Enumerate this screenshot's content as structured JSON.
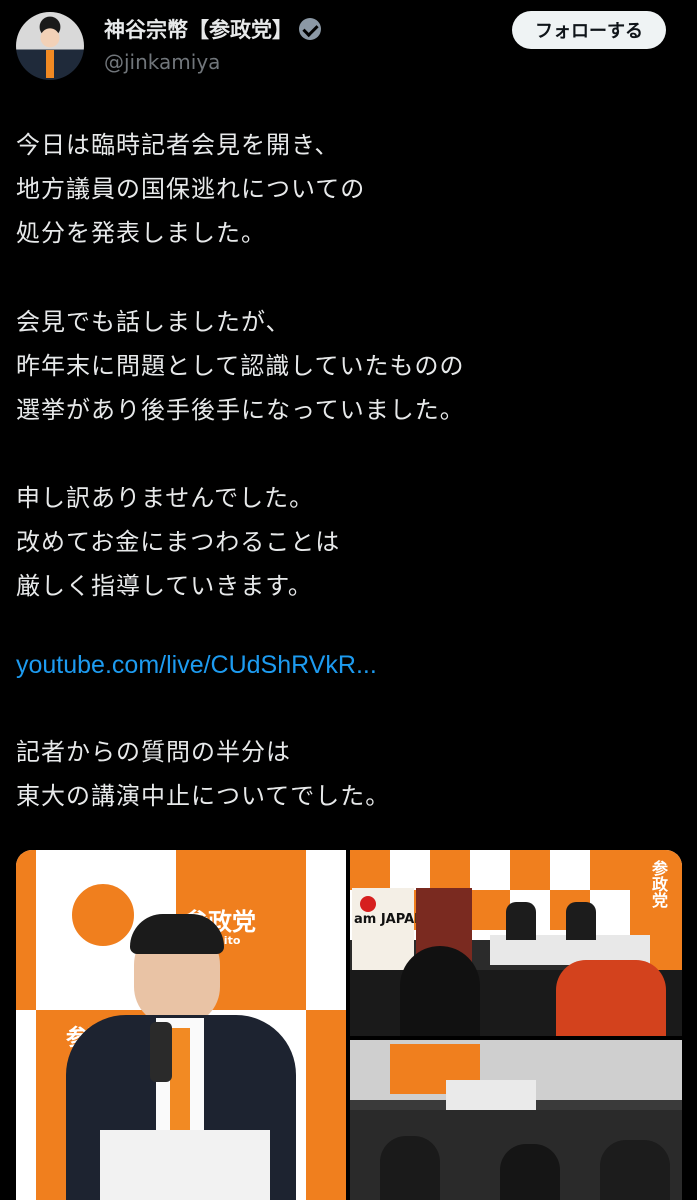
{
  "author": {
    "name": "神谷宗幣【参政党】",
    "handle": "@jinkamiya",
    "verified_icon": "verified-badge-icon"
  },
  "follow_button_label": "フォローする",
  "tweet": {
    "lines": [
      "今日は臨時記者会見を開き、",
      "地方議員の国保逃れについての",
      "処分を発表しました。",
      "会見でも話しましたが、",
      "昨年末に問題として認識していたものの",
      "選挙があり後手後手になっていました。",
      "申し訳ありませんでした。",
      "改めてお金にまつわることは",
      "厳しく指導していきます。",
      "記者からの質問の半分は",
      "東大の講演中止についてでした。"
    ],
    "link": "youtube.com/live/CUdShRVkR..."
  },
  "media": {
    "main_logo": "参政党",
    "main_logo_sub": "sanseito",
    "main_logo_2": "参政党",
    "side_logo": "参政党",
    "banner_text": "am JAPAN",
    "colors": {
      "orange": "#f07f1e",
      "white": "#ffffff"
    }
  }
}
